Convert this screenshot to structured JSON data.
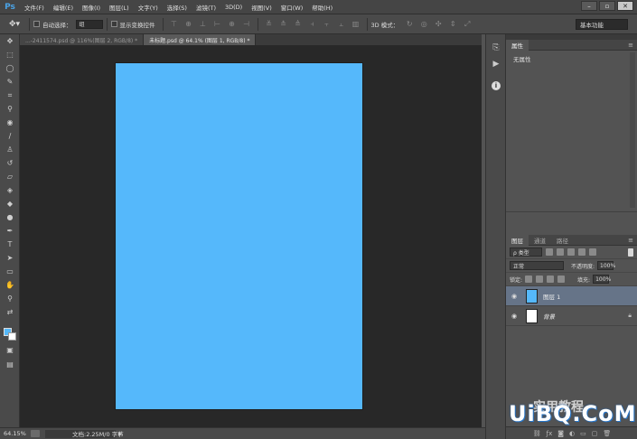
{
  "app": {
    "logo": "Ps"
  },
  "menu": [
    "文件(F)",
    "编辑(E)",
    "图像(I)",
    "图层(L)",
    "文字(Y)",
    "选择(S)",
    "滤镜(T)",
    "3D(D)",
    "视图(V)",
    "窗口(W)",
    "帮助(H)"
  ],
  "window_controls": {
    "minimize": "–",
    "restore": "▫",
    "close": "✕"
  },
  "options": {
    "auto_select_label": "自动选择：",
    "auto_select_value": "组",
    "show_transform_label": "显示变换控件",
    "mode_label": "3D 模式：",
    "workspace": "基本功能"
  },
  "tabs": [
    {
      "label": "...-2411574.psd @ 116%(图层 2, RGB/8) *",
      "active": false
    },
    {
      "label": "未标题.psd @ 64.1% (图层 1, RGB/8) *",
      "active": true
    }
  ],
  "status": {
    "zoom": "64.15%",
    "doc": "文档:2.25M/0 字节"
  },
  "properties": {
    "tab": "属性",
    "empty": "无属性"
  },
  "layers": {
    "tabs": [
      "图层",
      "通道",
      "路径"
    ],
    "filter": "ρ 类型",
    "blend": "正常",
    "opacity_label": "不透明度:",
    "opacity": "100%",
    "lock_label": "锁定:",
    "fill_label": "填充:",
    "fill": "100%",
    "items": [
      {
        "name": "图层 1",
        "selected": true,
        "color": "#55b8fb"
      },
      {
        "name": "背景",
        "selected": false,
        "color": "#ffffff"
      }
    ]
  },
  "document": {
    "fill_color": "#55b8fb"
  },
  "watermark": {
    "cn": "实用教程",
    "en": "UiBQ.CoM"
  }
}
